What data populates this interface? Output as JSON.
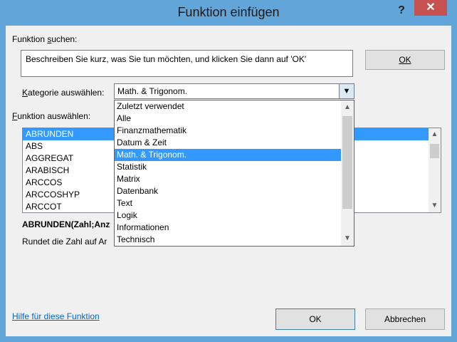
{
  "window": {
    "title": "Funktion einfügen",
    "help_glyph": "?",
    "close_glyph": "✕"
  },
  "search": {
    "label_pre": "Funktion ",
    "label_u": "s",
    "label_post": "uchen:",
    "text": "Beschreiben Sie kurz, was Sie tun möchten, und klicken Sie dann auf 'OK'",
    "button": "OK"
  },
  "category": {
    "label_u": "K",
    "label_post": "ategorie auswählen:",
    "selected": "Math. & Trigonom.",
    "options": [
      "Zuletzt verwendet",
      "Alle",
      "Finanzmathematik",
      "Datum & Zeit",
      "Math. & Trigonom.",
      "Statistik",
      "Matrix",
      "Datenbank",
      "Text",
      "Logik",
      "Informationen",
      "Technisch"
    ]
  },
  "functions": {
    "label_u": "F",
    "label_post": "unktion auswählen:",
    "items": [
      "ABRUNDEN",
      "ABS",
      "AGGREGAT",
      "ARABISCH",
      "ARCCOS",
      "ARCCOSHYP",
      "ARCCOT"
    ],
    "selected": "ABRUNDEN"
  },
  "description": {
    "signature": "ABRUNDEN(Zahl;Anz",
    "text": "Rundet die Zahl auf Ar"
  },
  "footer": {
    "help_link": "Hilfe für diese Funktion",
    "ok": "OK",
    "cancel": "Abbrechen"
  },
  "colors": {
    "frame": "#62a5d8",
    "selection": "#3399ff",
    "close": "#c75050",
    "link": "#0066cc"
  }
}
